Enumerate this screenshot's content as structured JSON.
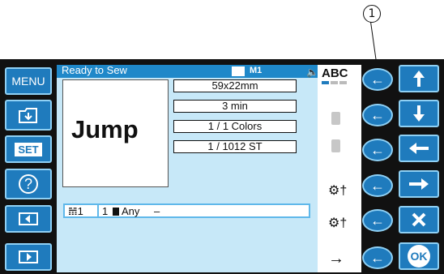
{
  "callout": {
    "number": "1"
  },
  "left_buttons": [
    {
      "id": "menu",
      "label": "MENU"
    },
    {
      "id": "folder",
      "label": ""
    },
    {
      "id": "set",
      "label": "SET"
    },
    {
      "id": "help",
      "label": "?"
    },
    {
      "id": "prev",
      "label": ""
    },
    {
      "id": "next",
      "label": ""
    }
  ],
  "status": {
    "text": "Ready to Sew",
    "memory": "M1",
    "abc": "ABC"
  },
  "preview": {
    "label": "Jump"
  },
  "info": {
    "size": "59x22mm",
    "time": "3 min",
    "colors": "1 / 1 Colors",
    "stitches": "1 / 1012   ST"
  },
  "thread_bar": {
    "needle": "1",
    "index": "1",
    "color_name": "Any",
    "dash": "–"
  },
  "right_buttons": [
    "up",
    "down",
    "left",
    "right",
    "cancel",
    "ok"
  ],
  "ok_label": "OK",
  "colors": {
    "button": "#1f7bbd",
    "button_border": "#8fd0f4",
    "screen": "#c7e8f8",
    "status": "#1f88c9"
  }
}
